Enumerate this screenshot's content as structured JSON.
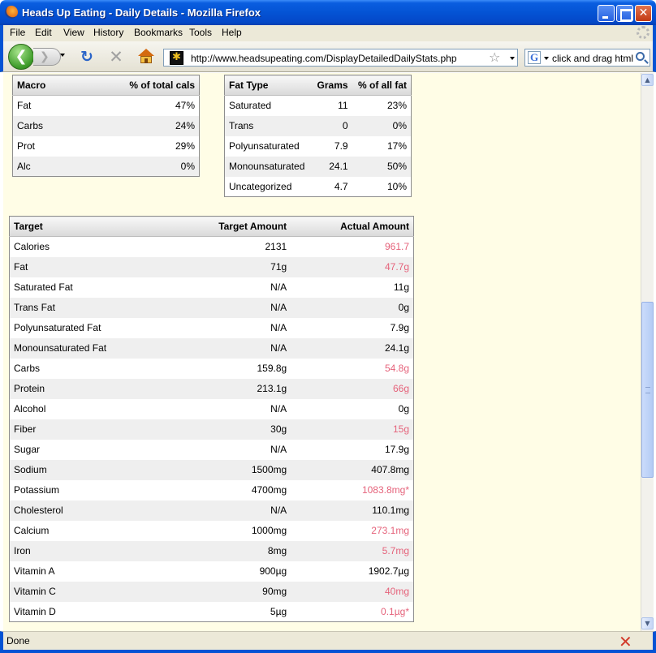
{
  "window": {
    "title": "Heads Up Eating - Daily Details - Mozilla Firefox"
  },
  "menu": [
    "File",
    "Edit",
    "View",
    "History",
    "Bookmarks",
    "Tools",
    "Help"
  ],
  "nav": {
    "url": "http://www.headsupeating.com/DisplayDetailedDailyStats.php",
    "search_value": "click and drag html in",
    "search_engine_icon": "G"
  },
  "macro_table": {
    "headers": [
      "Macro",
      "% of total cals"
    ],
    "rows": [
      [
        "Fat",
        "47%"
      ],
      [
        "Carbs",
        "24%"
      ],
      [
        "Prot",
        "29%"
      ],
      [
        "Alc",
        "0%"
      ]
    ]
  },
  "fat_table": {
    "headers": [
      "Fat Type",
      "Grams",
      "% of all fat"
    ],
    "rows": [
      [
        "Saturated",
        "11",
        "23%"
      ],
      [
        "Trans",
        "0",
        "0%"
      ],
      [
        "Polyunsaturated",
        "7.9",
        "17%"
      ],
      [
        "Monounsaturated",
        "24.1",
        "50%"
      ],
      [
        "Uncategorized",
        "4.7",
        "10%"
      ]
    ]
  },
  "target_table": {
    "headers": [
      "Target",
      "Target Amount",
      "Actual Amount"
    ],
    "rows": [
      [
        "Calories",
        "2131",
        "961.7",
        true
      ],
      [
        "Fat",
        "71g",
        "47.7g",
        true
      ],
      [
        "Saturated Fat",
        "N/A",
        "11g",
        false
      ],
      [
        "Trans Fat",
        "N/A",
        "0g",
        false
      ],
      [
        "Polyunsaturated Fat",
        "N/A",
        "7.9g",
        false
      ],
      [
        "Monounsaturated Fat",
        "N/A",
        "24.1g",
        false
      ],
      [
        "Carbs",
        "159.8g",
        "54.8g",
        true
      ],
      [
        "Protein",
        "213.1g",
        "66g",
        true
      ],
      [
        "Alcohol",
        "N/A",
        "0g",
        false
      ],
      [
        "Fiber",
        "30g",
        "15g",
        true
      ],
      [
        "Sugar",
        "N/A",
        "17.9g",
        false
      ],
      [
        "Sodium",
        "1500mg",
        "407.8mg",
        false
      ],
      [
        "Potassium",
        "4700mg",
        "1083.8mg*",
        true
      ],
      [
        "Cholesterol",
        "N/A",
        "110.1mg",
        false
      ],
      [
        "Calcium",
        "1000mg",
        "273.1mg",
        true
      ],
      [
        "Iron",
        "8mg",
        "5.7mg",
        true
      ],
      [
        "Vitamin A",
        "900µg",
        "1902.7µg",
        false
      ],
      [
        "Vitamin C",
        "90mg",
        "40mg",
        true
      ],
      [
        "Vitamin D",
        "5µg",
        "0.1µg*",
        true
      ]
    ]
  },
  "status": {
    "text": "Done"
  },
  "colors": {
    "under_target": "#e5637b",
    "page_background": "#fffde6",
    "titlebar": "#0453d4"
  }
}
